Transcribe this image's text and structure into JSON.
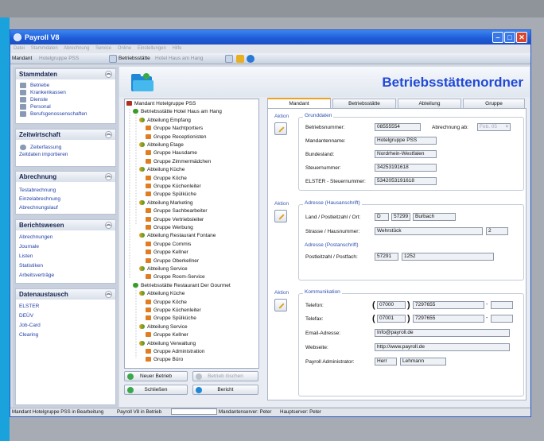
{
  "window": {
    "title": "Payroll V8"
  },
  "menu": [
    "Datei",
    "Stammdaten",
    "Abrechnung",
    "Service",
    "Online",
    "Einstellungen",
    "Hilfe"
  ],
  "context": {
    "mandant_label": "Mandant",
    "mandant_value": "Hotelgruppe PSS",
    "betrieb_label": "Betriebsstätte",
    "betrieb_value": "Hotel Haus am Hang"
  },
  "sidebar": {
    "stammdaten": {
      "title": "Stammdaten",
      "items": [
        "Betriebe",
        "Krankenkassen",
        "Dienste",
        "Personal",
        "Berufsgenossenschaften"
      ]
    },
    "zeitwirtschaft": {
      "title": "Zeitwirtschaft",
      "items": [
        "Zeiterfassung",
        "Zeitdaten importieren"
      ]
    },
    "abrechnung": {
      "title": "Abrechnung",
      "items": [
        "Testabrechnung",
        "Einzelabrechnung",
        "Abrechnungslauf"
      ]
    },
    "berichtswesen": {
      "title": "Berichtswesen",
      "items": [
        "Abrechnungen",
        "Journale",
        "Listen",
        "Statistiken",
        "Arbeitsverträge"
      ]
    },
    "datenaustausch": {
      "title": "Datenaustausch",
      "items": [
        "ELSTER",
        "DEÜV",
        "Job-Card",
        "Clearing"
      ]
    }
  },
  "header": {
    "title": "Betriebsstättenordner"
  },
  "tree": [
    "Mandant Hotelgruppe PSS",
    "Betriebsstätte Hotel Haus am Hang",
    "Abteilung Empfang",
    "Gruppe Nachtportiers",
    "Gruppe Receptionisten",
    "Abteilung Etage",
    "Gruppe Hausdame",
    "Gruppe Zimmermädchen",
    "Abteilung Küche",
    "Gruppe Köche",
    "Gruppe Küchenleiter",
    "Gruppe Spülküche",
    "Abteilung Marketing",
    "Gruppe Sachbearbeiter",
    "Gruppe Vertriebsleiter",
    "Gruppe Werbung",
    "Abteilung Restaurant Fontane",
    "Gruppe Commis",
    "Gruppe Kellner",
    "Gruppe Oberkellner",
    "Abteilung Service",
    "Gruppe Room-Service",
    "Betriebsstätte Restaurant Der Gourmet",
    "Abteilung Küche",
    "Gruppe Köche",
    "Gruppe Küchenleiter",
    "Gruppe Spülküche",
    "Abteilung Service",
    "Gruppe Kellner",
    "Abteilung Verwaltung",
    "Gruppe Administration",
    "Gruppe Büro"
  ],
  "buttons": {
    "neuer_betrieb": "Neuer Betrieb",
    "betrieb_loeschen": "Betrieb löschen",
    "schliessen": "Schließen",
    "bericht": "Bericht"
  },
  "tabs": [
    "Mandant",
    "Betriebsstätte",
    "Abteilung",
    "Gruppe"
  ],
  "form": {
    "aktion": "Aktion",
    "grunddaten": {
      "title": "Grunddaten",
      "betriebsnummer_label": "Betriebsnummer:",
      "betriebsnummer": "08555554",
      "abrechnung_ab_label": "Abrechnung ab:",
      "abrechnung_ab": "Feb. 05",
      "mandantenname_label": "Mandantenname:",
      "mandantenname": "Hotelgruppe PSS",
      "bundesland_label": "Bundesland:",
      "bundesland": "Nordrhein-Westfalen",
      "steuernummer_label": "Steuernummer:",
      "steuernummer": "34253191618",
      "elster_label": "ELSTER - Steuernummer:",
      "elster": "5342053191618"
    },
    "adresse_haus": {
      "title": "Adresse (Hausanschrift)",
      "land_label": "Land / Postleitzahl / Ort:",
      "land": "D",
      "plz": "57299",
      "ort": "Burbach",
      "strasse_label": "Strasse / Hausnummer:",
      "strasse": "Wehrstück",
      "hausnummer": "2"
    },
    "adresse_post": {
      "title": "Adresse (Postanschrift)",
      "label": "Postleitzahl / Postfach:",
      "plz": "57291",
      "postfach": "1252"
    },
    "kommunikation": {
      "title": "Kommunikation",
      "telefon_label": "Telefon:",
      "telefon_vorwahl": "07000",
      "telefon_nummer": "7297655",
      "telefax_label": "Telefax:",
      "telefax_vorwahl": "07001",
      "telefax_nummer": "7297655",
      "email_label": "Email-Adresse:",
      "email": "Info@payroll.de",
      "web_label": "Webseite:",
      "web": "http://www.payroll.de",
      "admin_label": "Payroll Administrator:",
      "admin_anrede": "Herr",
      "admin_name": "Lehmann"
    }
  },
  "status": {
    "s1": "Mandant Hotelgruppe PSS in Bearbeitung",
    "s2": "Payroll V8 in Betrieb",
    "s3": "Mandantenserver: Peter",
    "s4": "Hauptserver: Peter"
  }
}
